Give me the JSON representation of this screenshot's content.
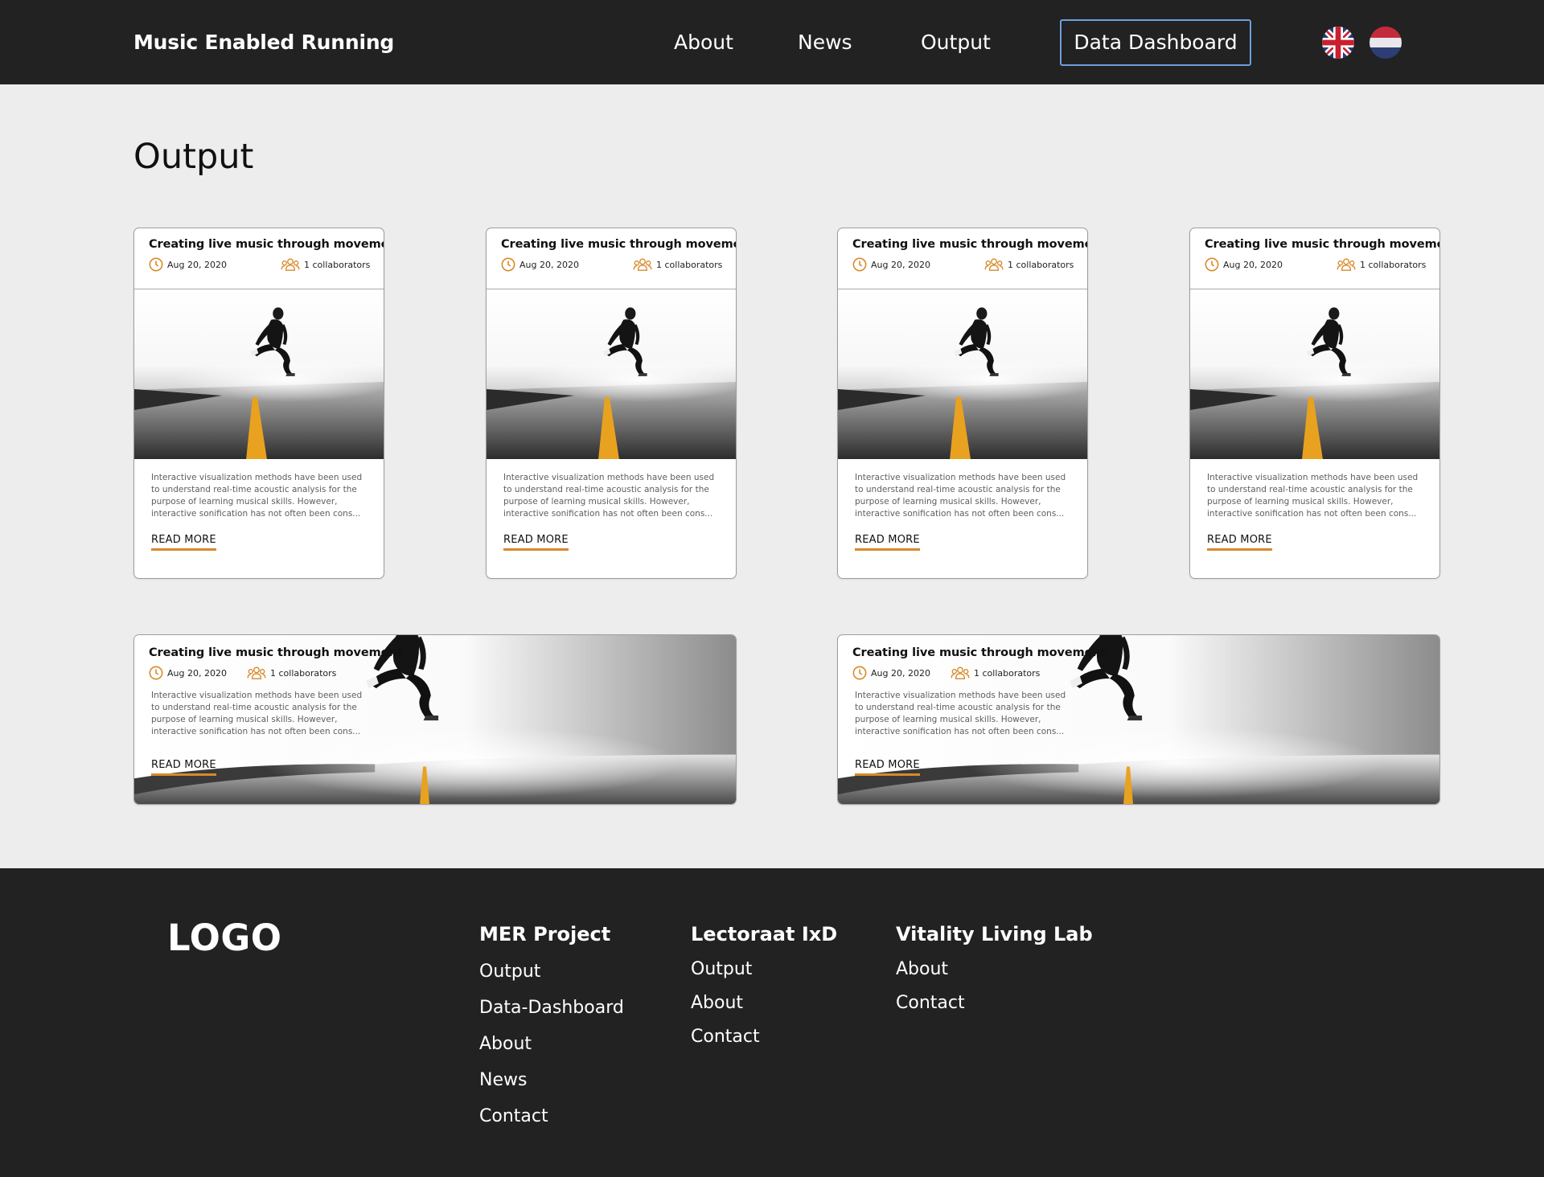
{
  "header": {
    "brand": "Music Enabled Running",
    "nav": [
      "About",
      "News",
      "Output"
    ],
    "cta": "Data Dashboard",
    "languages": [
      "uk-flag-icon",
      "nl-flag-icon"
    ]
  },
  "page": {
    "title": "Output"
  },
  "cards": [
    {
      "title": "Creating live music through movement",
      "date": "Aug 20, 2020",
      "collaborators": "1 collaborators",
      "description": "Interactive visualization methods have been used to understand real-time acoustic analysis for the purpose of learning musical skills. However, interactive sonification has not often been cons...",
      "read_more": "READ MORE"
    },
    {
      "title": "Creating live music through movement",
      "date": "Aug 20, 2020",
      "collaborators": "1 collaborators",
      "description": "Interactive visualization methods have been used to understand real-time acoustic analysis for the purpose of learning musical skills. However, interactive sonification has not often been cons...",
      "read_more": "READ MORE"
    },
    {
      "title": "Creating live music through movement",
      "date": "Aug 20, 2020",
      "collaborators": "1 collaborators",
      "description": "Interactive visualization methods have been used to understand real-time acoustic analysis for the purpose of learning musical skills. However, interactive sonification has not often been cons...",
      "read_more": "READ MORE"
    },
    {
      "title": "Creating live music through movement",
      "date": "Aug 20, 2020",
      "collaborators": "1 collaborators",
      "description": "Interactive visualization methods have been used to understand real-time acoustic analysis for the purpose of learning musical skills. However, interactive sonification has not often been cons...",
      "read_more": "READ MORE"
    }
  ],
  "wide_cards": [
    {
      "title": "Creating live music through movement",
      "date": "Aug 20, 2020",
      "collaborators": "1 collaborators",
      "description": "Interactive visualization methods have been used to understand real-time acoustic analysis for the purpose of learning musical skills. However, interactive sonification has not often been cons...",
      "read_more": "READ MORE"
    },
    {
      "title": "Creating live music through movement",
      "date": "Aug 20, 2020",
      "collaborators": "1 collaborators",
      "description": "Interactive visualization methods have been used to understand real-time acoustic analysis for the purpose of learning musical skills. However, interactive sonification has not often been cons...",
      "read_more": "READ MORE"
    }
  ],
  "footer": {
    "logo": "LOGO",
    "columns": [
      {
        "heading": "MER Project",
        "links": [
          "Output",
          "Data-Dashboard",
          "About",
          "News",
          "Contact"
        ]
      },
      {
        "heading": "Lectoraat IxD",
        "links": [
          "Output",
          "About",
          "Contact"
        ]
      },
      {
        "heading": "Vitality Living Lab",
        "links": [
          "About",
          "Contact"
        ]
      }
    ]
  },
  "colors": {
    "header_bg": "#222222",
    "page_bg": "#ededed",
    "accent": "#d88a28",
    "cta_border": "#6e9ee0"
  }
}
